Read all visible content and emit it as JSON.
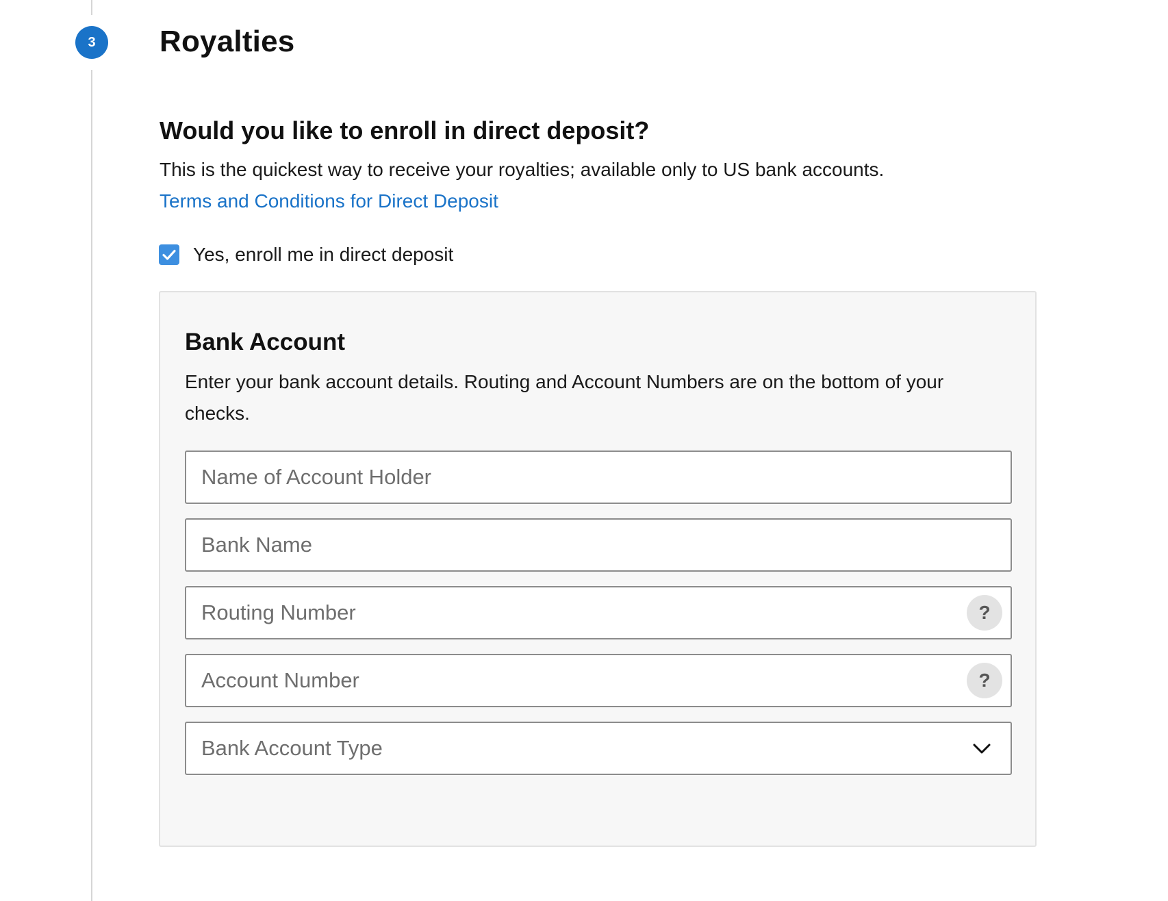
{
  "step": {
    "number": "3",
    "title": "Royalties"
  },
  "direct_deposit": {
    "question": "Would you like to enroll in direct deposit?",
    "description": "This is the quickest way to receive your royalties; available only to US bank accounts.",
    "terms_link": "Terms and Conditions for Direct Deposit",
    "enroll_label": "Yes, enroll me in direct deposit",
    "enrolled": true
  },
  "bank_account": {
    "title": "Bank Account",
    "description": "Enter your bank account details. Routing and Account Numbers are on the bottom of your checks.",
    "fields": {
      "holder_name": {
        "placeholder": "Name of Account Holder",
        "value": ""
      },
      "bank_name": {
        "placeholder": "Bank Name",
        "value": ""
      },
      "routing_number": {
        "placeholder": "Routing Number",
        "value": "",
        "help": "?"
      },
      "account_number": {
        "placeholder": "Account Number",
        "value": "",
        "help": "?"
      },
      "account_type": {
        "placeholder": "Bank Account Type"
      }
    }
  },
  "icons": {
    "checkbox": "checkmark-icon",
    "help": "question-circle-icon",
    "select": "chevron-down-icon"
  },
  "colors": {
    "accent": "#1a73c8",
    "checkbox": "#3d8fe0",
    "panel_bg": "#f7f7f7",
    "field_border": "#8c8c8c"
  }
}
